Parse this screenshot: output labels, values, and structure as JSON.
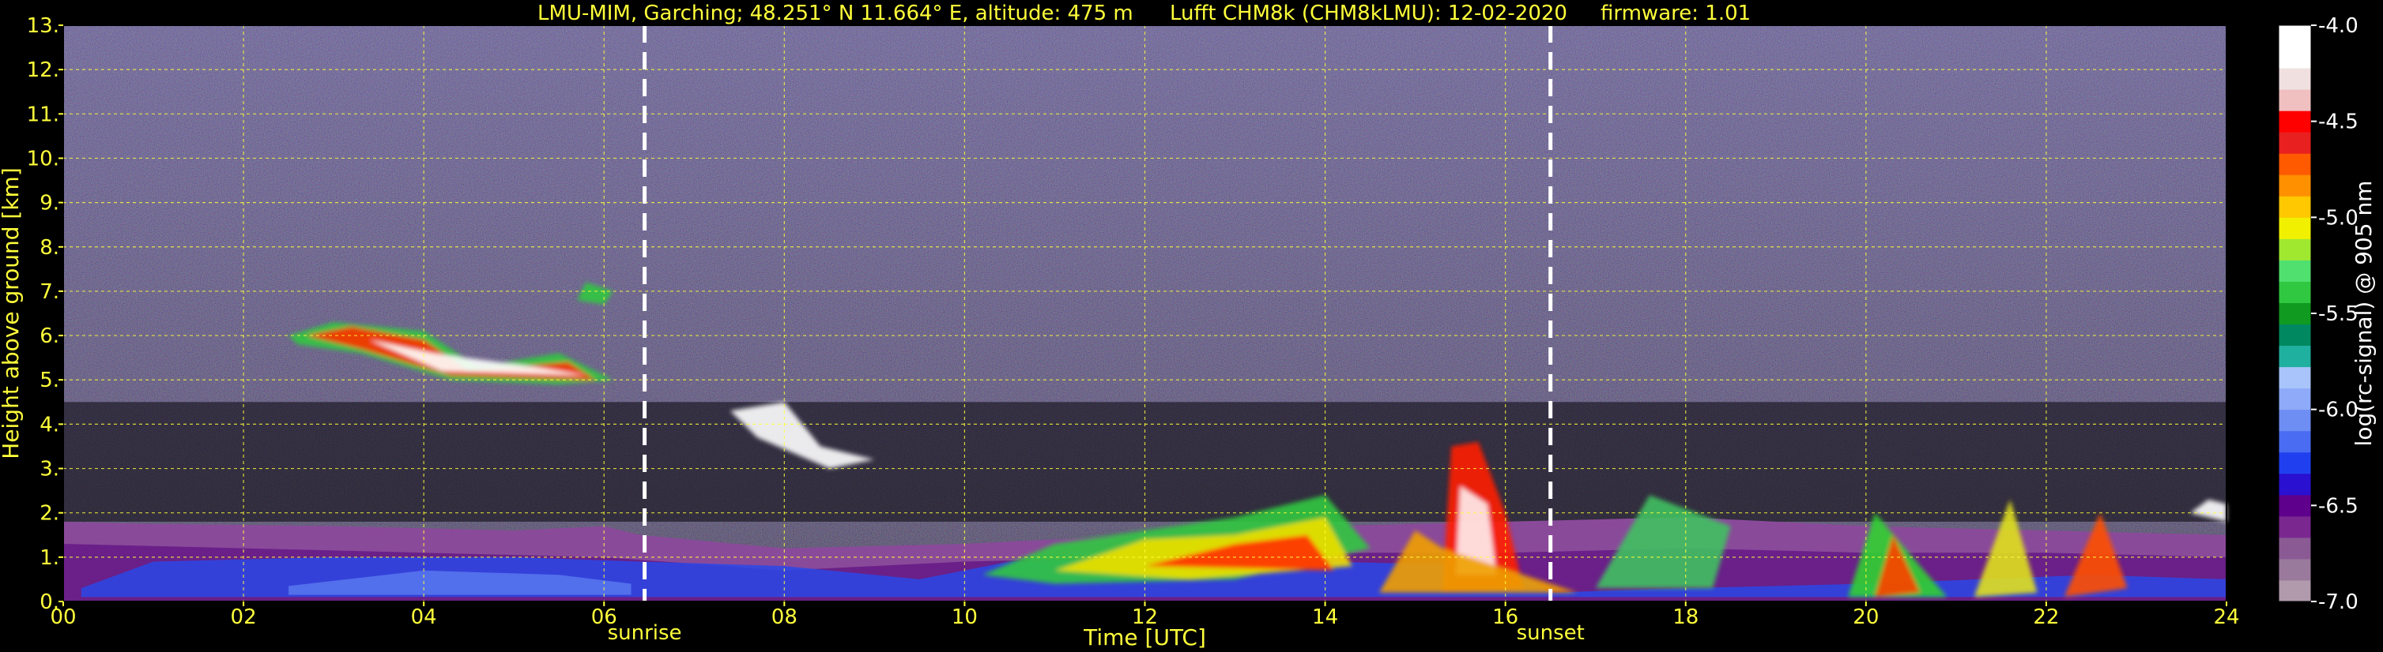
{
  "title": {
    "location": "LMU-MIM, Garching; 48.251° N 11.664° E, altitude: 475 m",
    "instrument": "Lufft CHM8k (CHM8kLMU): 12-02-2020",
    "firmware": "firmware: 1.01"
  },
  "chart_data": {
    "type": "heatmap",
    "xlabel": "Time [UTC]",
    "ylabel": "Height above ground [km]",
    "colorbar_label": "log(rc-signal) @ 905 nm",
    "xlim": [
      0,
      24
    ],
    "ylim": [
      0,
      13
    ],
    "clim": [
      -7.0,
      -4.0
    ],
    "x_ticks": [
      0,
      2,
      4,
      6,
      8,
      10,
      12,
      14,
      16,
      18,
      20,
      22,
      24
    ],
    "x_tick_labels": [
      "00",
      "02",
      "04",
      "06",
      "08",
      "10",
      "12",
      "14",
      "16",
      "18",
      "20",
      "22",
      "24"
    ],
    "y_ticks": [
      0,
      1,
      2,
      3,
      4,
      5,
      6,
      7,
      8,
      9,
      10,
      11,
      12,
      13
    ],
    "y_tick_labels": [
      "0.",
      "1.",
      "2.",
      "3.",
      "4.",
      "5.",
      "6.",
      "7.",
      "8.",
      "9.",
      "10.",
      "11.",
      "12.",
      "13."
    ],
    "colorbar_ticks": [
      -4.0,
      -4.5,
      -5.0,
      -5.5,
      -6.0,
      -6.5,
      -7.0
    ],
    "colorbar_tick_labels": [
      "-4.0",
      "-4.5",
      "-5.0",
      "-5.5",
      "-6.0",
      "-6.5",
      "-7.0"
    ],
    "colorbar_colors": [
      "#b09aac",
      "#9a7a9c",
      "#8a5a94",
      "#7a2890",
      "#5e008c",
      "#2a10d0",
      "#2040f0",
      "#4a6cf2",
      "#6e8ef4",
      "#8eaaf8",
      "#a8c4fa",
      "#20b0a0",
      "#008860",
      "#109a20",
      "#30c840",
      "#50e070",
      "#a0e830",
      "#f0f000",
      "#ffc800",
      "#ff9000",
      "#ff5a00",
      "#e82020",
      "#ff0000",
      "#f0c0c0",
      "#f0e0e0",
      "#ffffff",
      "#ffffff"
    ],
    "annotations": [
      {
        "label": "sunrise",
        "time": 6.45
      },
      {
        "label": "sunset",
        "time": 16.5
      }
    ],
    "grid": true,
    "grid_color": "#ffff3a",
    "label_color": "#ffff3a",
    "background": "#000000"
  }
}
